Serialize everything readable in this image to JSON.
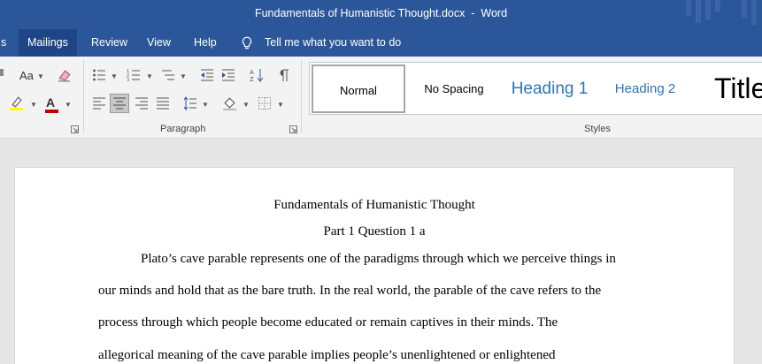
{
  "window": {
    "title": "Fundamentals of Humanistic Thought.docx  -  Word"
  },
  "menu": {
    "tabs": [
      {
        "label": "s"
      },
      {
        "label": "Mailings"
      },
      {
        "label": "Review"
      },
      {
        "label": "View"
      },
      {
        "label": "Help"
      }
    ],
    "tell_me": "Tell me what you want to do"
  },
  "ribbon": {
    "font": {
      "change_case_label": "Aa",
      "font_color_label": "A"
    },
    "paragraph_group_label": "Paragraph",
    "styles_group_label": "Styles",
    "styles": [
      {
        "label": "Normal"
      },
      {
        "label": "No Spacing"
      },
      {
        "label": "Heading 1"
      },
      {
        "label": "Heading 2"
      },
      {
        "label": "Title"
      }
    ]
  },
  "colors": {
    "title_bar": "#2b579a",
    "active_tab": "#1e4686",
    "heading_blue": "#2e74b5",
    "font_color_red": "#c00000",
    "highlight_yellow": "#ffff00"
  },
  "document": {
    "title": "Fundamentals of Humanistic Thought",
    "subtitle": "Part 1 Question 1 a",
    "lines": [
      "Plato’s cave parable represents one of the paradigms through which we perceive things in",
      "our minds and hold that as the bare truth. In the real world, the parable of the cave refers to the",
      "process through which people become educated or remain captives in their minds. The",
      "allegorical meaning of the cave parable implies people’s unenlightened or enlightened"
    ]
  }
}
